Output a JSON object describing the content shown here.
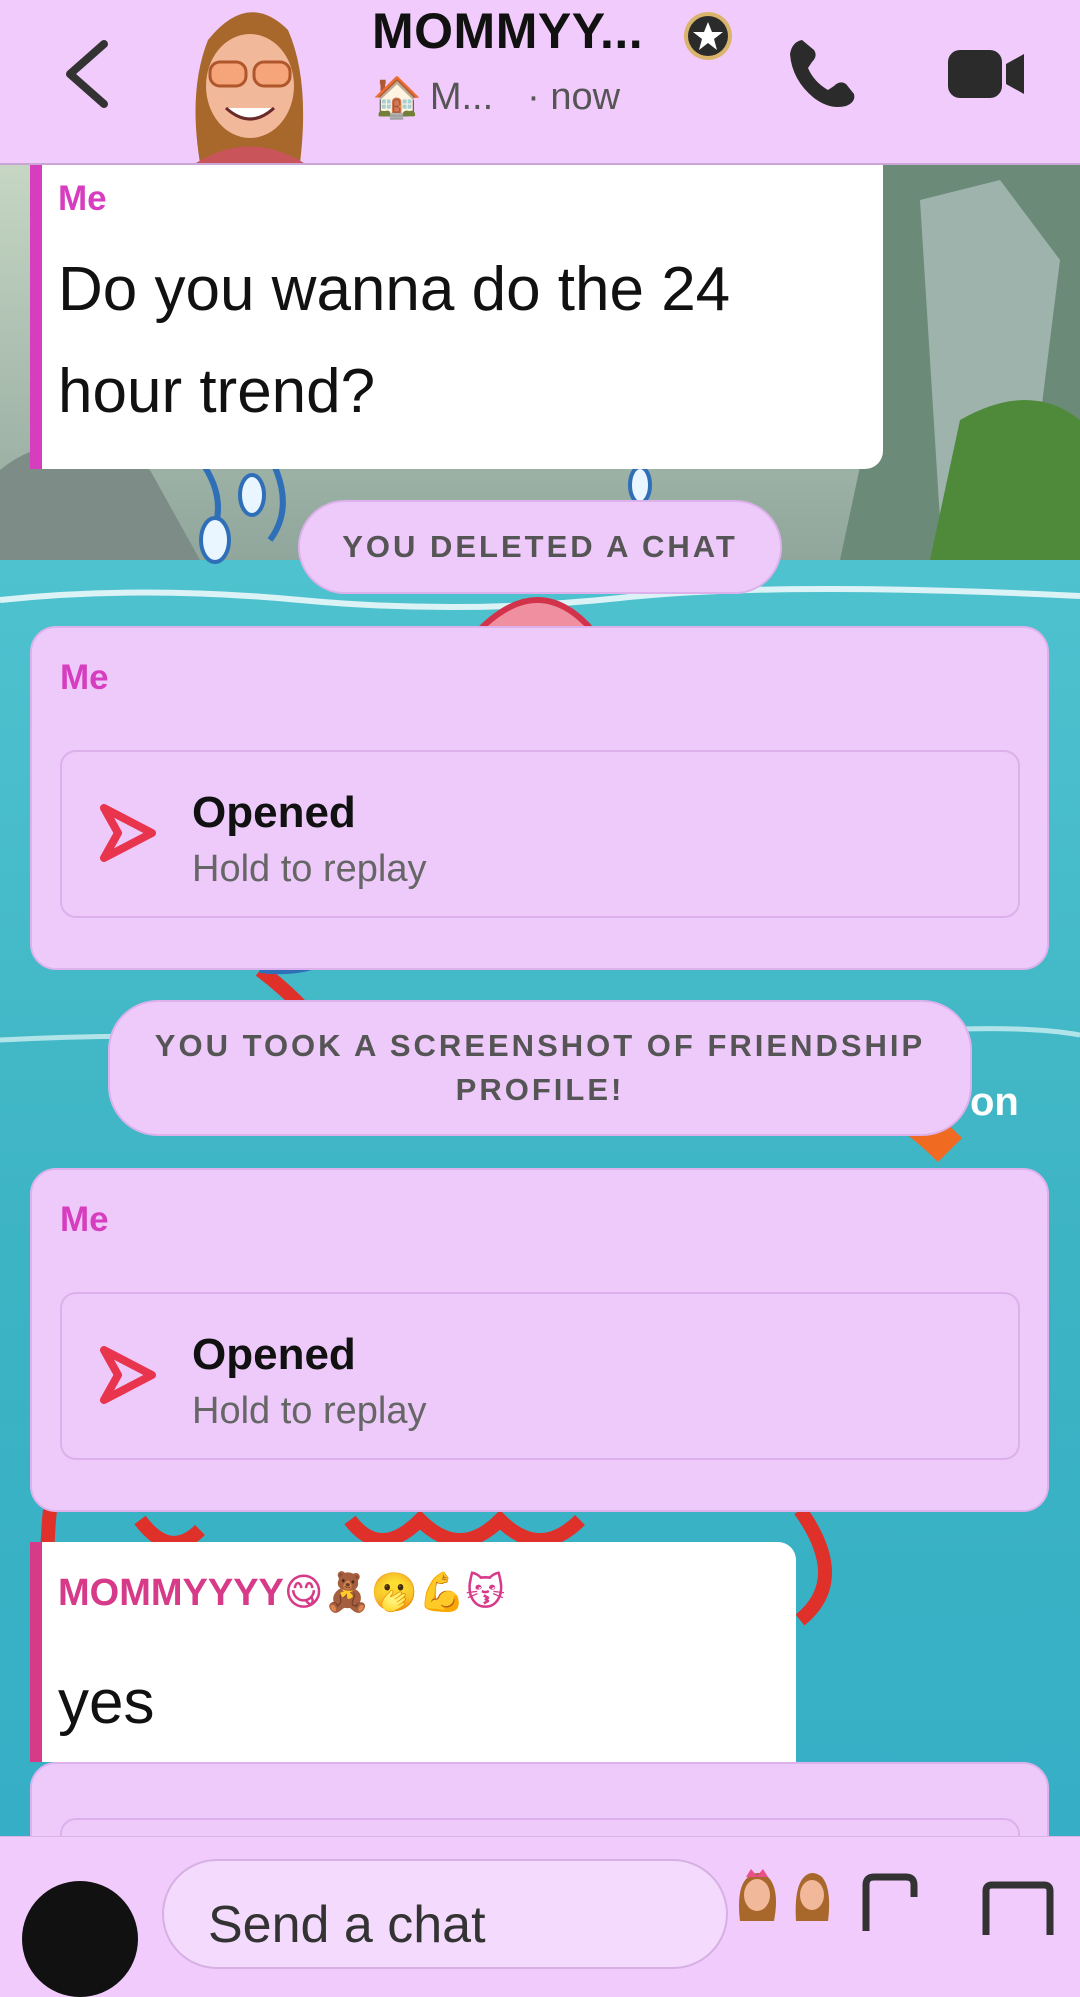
{
  "header": {
    "title": "MOMMYY...",
    "status_icon": "house-emoji",
    "status_text": "M...",
    "time": "· now"
  },
  "messages": [
    {
      "type": "text",
      "sender": "Me",
      "text_line1": "Do you wanna do the 24",
      "text_line2": "hour trend?"
    },
    {
      "type": "system",
      "text": "YOU DELETED A CHAT"
    },
    {
      "type": "snap",
      "sender": "Me",
      "title": "Opened",
      "subtitle": "Hold to replay"
    },
    {
      "type": "system",
      "text_line1": "YOU TOOK A SCREENSHOT OF FRIENDSHIP",
      "text_line2": "PROFILE!"
    },
    {
      "type": "snap",
      "sender": "Me",
      "title": "Opened",
      "subtitle": "Hold to replay"
    },
    {
      "type": "text",
      "sender": "MOMMYYYY😋🧸🫢💪😽",
      "text": "yes"
    }
  ],
  "background": {
    "partial_text": "on"
  },
  "composer": {
    "placeholder": "Send a chat"
  },
  "colors": {
    "header_bg": "#f0cbfb",
    "me_accent": "#d63ebf",
    "friend_accent": "#d63a88",
    "snap_red": "#e8344c",
    "water": "#3cb9c8"
  }
}
